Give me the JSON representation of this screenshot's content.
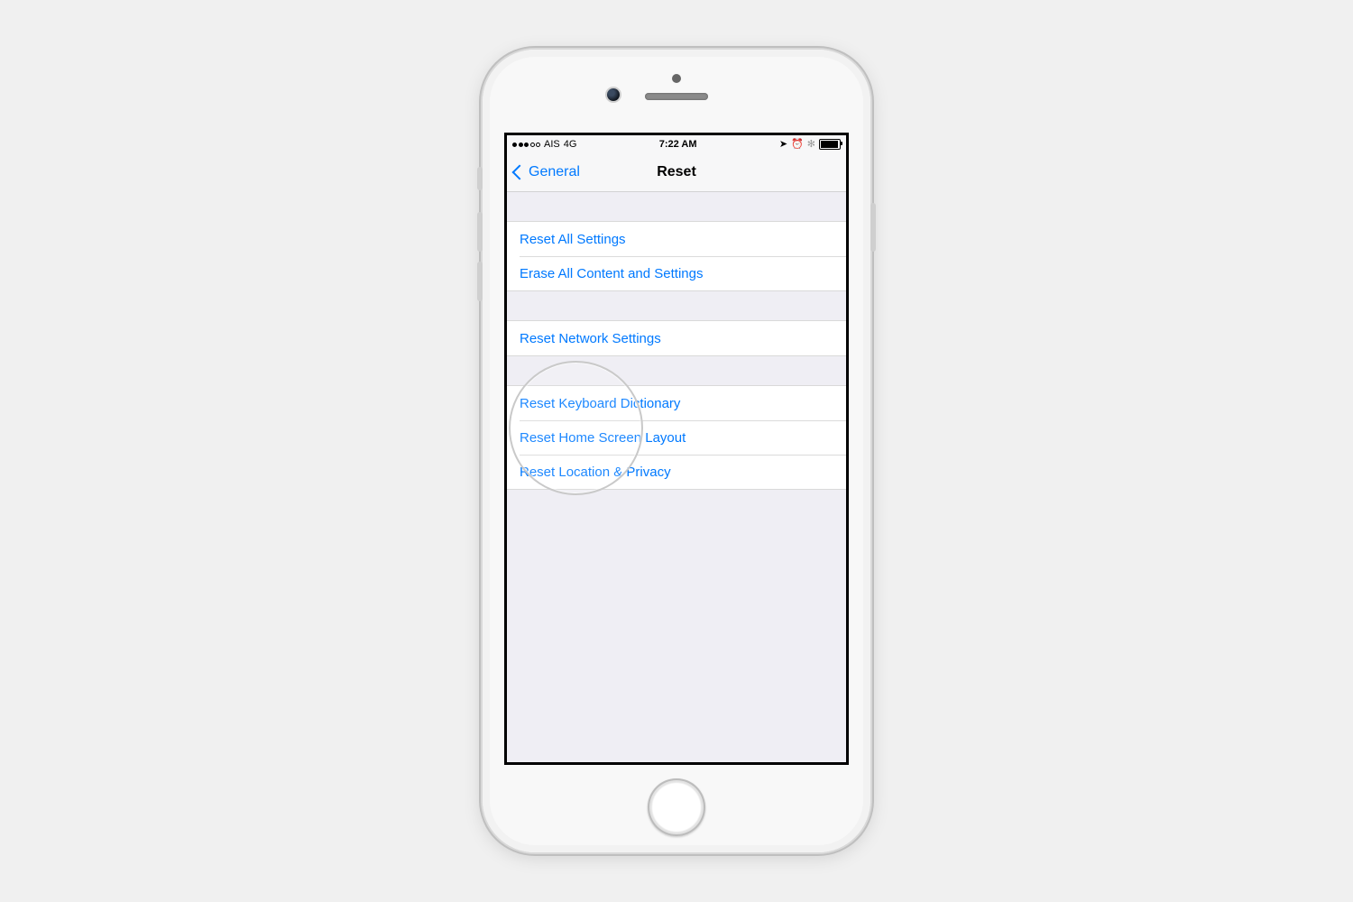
{
  "status": {
    "carrier": "AIS",
    "network": "4G",
    "signal_filled": 3,
    "signal_total": 5,
    "time": "7:22 AM",
    "icons": {
      "location": "➤",
      "alarm": "⏰",
      "bluetooth": "✻"
    },
    "battery_pct": 85
  },
  "nav": {
    "back_label": "General",
    "title": "Reset"
  },
  "groups": [
    {
      "rows": [
        {
          "label": "Reset All Settings"
        },
        {
          "label": "Erase All Content and Settings"
        }
      ]
    },
    {
      "rows": [
        {
          "label": "Reset Network Settings"
        }
      ]
    },
    {
      "rows": [
        {
          "label": "Reset Keyboard Dictionary"
        },
        {
          "label": "Reset Home Screen Layout"
        },
        {
          "label": "Reset Location & Privacy"
        }
      ]
    }
  ],
  "highlight": {
    "target_row": "Reset Keyboard Dictionary"
  }
}
